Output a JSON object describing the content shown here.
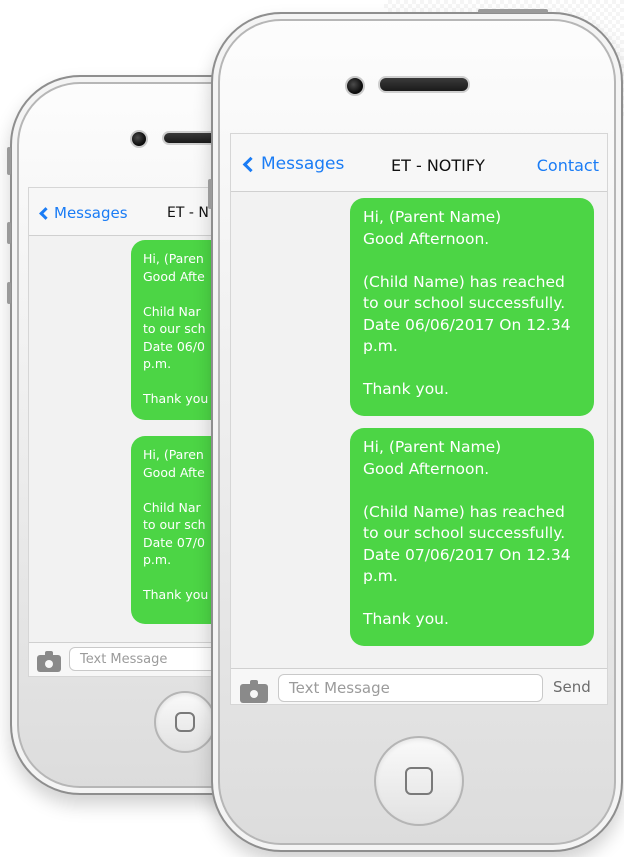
{
  "header": {
    "back_label": "Messages",
    "title": "ET - NOTIFY",
    "contact_label": "Contact"
  },
  "messages": [
    {
      "text": "Hi, (Parent Name)\nGood Afternoon.\n\n(Child Name) has reached\nto our school successfully.\nDate 06/06/2017 On 12.34\np.m.\n\nThank you."
    },
    {
      "text": "Hi, (Parent Name)\nGood Afternoon.\n\n(Child Name) has reached\nto our school successfully.\nDate 07/06/2017 On 12.34\np.m.\n\nThank you."
    }
  ],
  "back_phone": {
    "title_visible": "ET - N",
    "messages": [
      {
        "text": "Hi, (Paren\nGood Afte\n\n Child Nar\nto our sch\nDate 06/0\np.m.\n\nThank you"
      },
      {
        "text": "Hi, (Paren\nGood Afte\n\n Child Nar\nto our sch\nDate 07/0\np.m.\n\nThank you"
      }
    ]
  },
  "composer": {
    "placeholder": "Text Message",
    "send_label": "Send"
  },
  "icons": {
    "back": "chevron-left-icon",
    "camera": "camera-icon",
    "home": "home-button-icon"
  },
  "colors": {
    "bubble": "#4cd545",
    "link": "#1a7cf5"
  }
}
